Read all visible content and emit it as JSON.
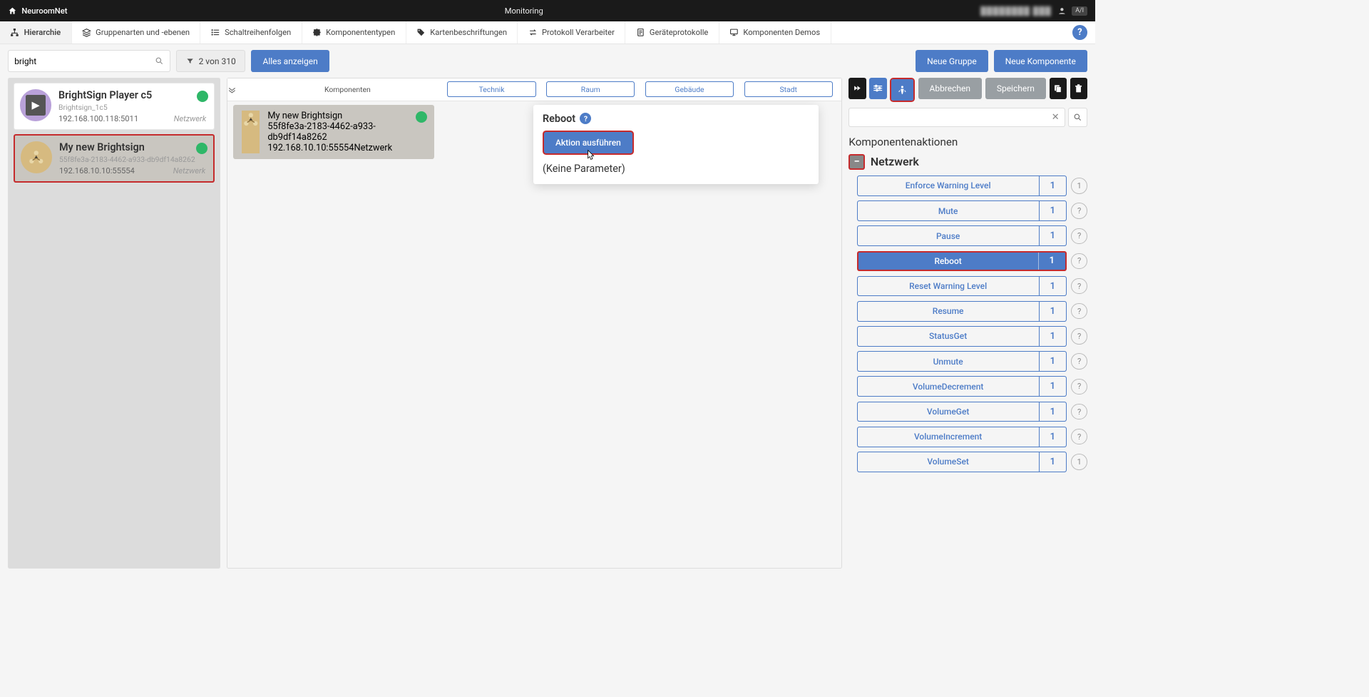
{
  "header": {
    "brand": "NeuroomNet",
    "title": "Monitoring",
    "user_masked": "████████ ███",
    "kbd": "A/I"
  },
  "tabs": [
    {
      "icon": "sitemap",
      "label": "Hierarchie"
    },
    {
      "icon": "layers",
      "label": "Gruppenarten und -ebenen"
    },
    {
      "icon": "list",
      "label": "Schaltreihenfolgen"
    },
    {
      "icon": "puzzle",
      "label": "Komponententypen"
    },
    {
      "icon": "tag",
      "label": "Kartenbeschriftungen"
    },
    {
      "icon": "swap",
      "label": "Protokoll Verarbeiter"
    },
    {
      "icon": "doc",
      "label": "Geräteprotokolle"
    },
    {
      "icon": "monitor",
      "label": "Komponenten Demos"
    }
  ],
  "filter": {
    "search_value": "bright",
    "count_text": "2 von 310",
    "show_all": "Alles anzeigen",
    "new_group": "Neue Gruppe",
    "new_component": "Neue Komponente"
  },
  "left_items": [
    {
      "title": "BrightSign Player c5",
      "sub": "Brightsign_1c5",
      "ip": "192.168.100.118:5011",
      "net": "Netzwerk",
      "kind": "purple",
      "selected": false
    },
    {
      "title": "My new Brightsign",
      "sub": "55f8fe3a-2183-4462-a933-db9df14a8262",
      "ip": "192.168.10.10:55554",
      "net": "Netzwerk",
      "kind": "sand",
      "selected": true
    }
  ],
  "mid": {
    "col_label": "Komponenten",
    "pills": [
      "Technik",
      "Raum",
      "Gebäude",
      "Stadt"
    ],
    "card": {
      "title": "My new Brightsign",
      "sub": "55f8fe3a-2183-4462-a933-db9df14a8262",
      "ip": "192.168.10.10:55554",
      "net": "Netzwerk"
    }
  },
  "popup": {
    "title": "Reboot",
    "exec": "Aktion ausführen",
    "noparams": "(Keine Parameter)"
  },
  "right": {
    "cancel": "Abbrechen",
    "save": "Speichern",
    "section": "Komponentenaktionen",
    "group": "Netzwerk",
    "actions": [
      {
        "label": "Enforce Warning Level",
        "count": "1",
        "q": "1",
        "active": false
      },
      {
        "label": "Mute",
        "count": "1",
        "q": "?",
        "active": false
      },
      {
        "label": "Pause",
        "count": "1",
        "q": "?",
        "active": false
      },
      {
        "label": "Reboot",
        "count": "1",
        "q": "?",
        "active": true
      },
      {
        "label": "Reset Warning Level",
        "count": "1",
        "q": "?",
        "active": false
      },
      {
        "label": "Resume",
        "count": "1",
        "q": "?",
        "active": false
      },
      {
        "label": "StatusGet",
        "count": "1",
        "q": "?",
        "active": false
      },
      {
        "label": "Unmute",
        "count": "1",
        "q": "?",
        "active": false
      },
      {
        "label": "VolumeDecrement",
        "count": "1",
        "q": "?",
        "active": false
      },
      {
        "label": "VolumeGet",
        "count": "1",
        "q": "?",
        "active": false
      },
      {
        "label": "VolumeIncrement",
        "count": "1",
        "q": "?",
        "active": false
      },
      {
        "label": "VolumeSet",
        "count": "1",
        "q": "1",
        "active": false
      }
    ]
  }
}
